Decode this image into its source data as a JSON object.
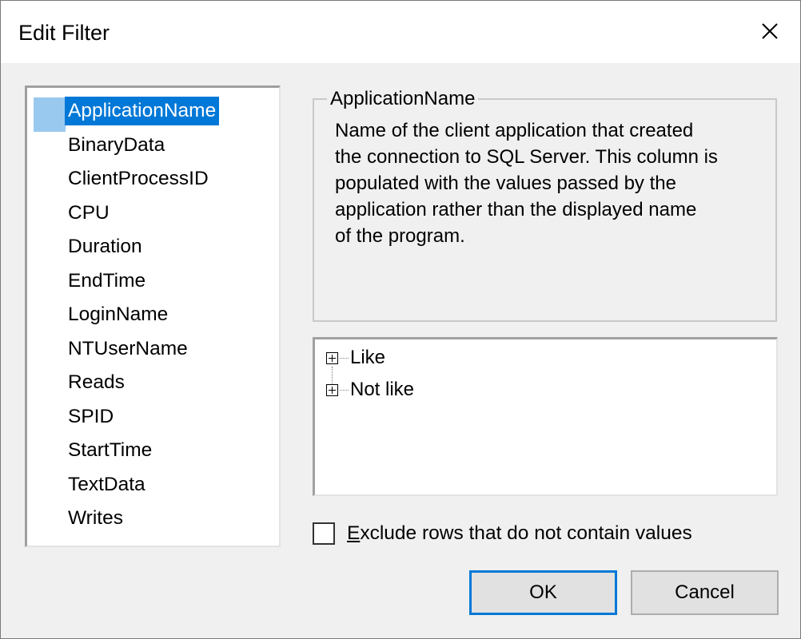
{
  "window": {
    "title": "Edit Filter",
    "close_icon": "close-icon"
  },
  "fields": {
    "selected": "ApplicationName",
    "items": [
      "ApplicationName",
      "BinaryData",
      "ClientProcessID",
      "CPU",
      "Duration",
      "EndTime",
      "LoginName",
      "NTUserName",
      "Reads",
      "SPID",
      "StartTime",
      "TextData",
      "Writes"
    ]
  },
  "description": {
    "heading": "ApplicationName",
    "lines": [
      "Name of the client application that created",
      "the connection to SQL Server. This column is",
      "populated with the values passed by the",
      "application rather than the displayed name",
      "of the program."
    ]
  },
  "operators": {
    "expander_icon": "plus-box-icon",
    "items": [
      "Like",
      "Not like"
    ]
  },
  "exclude": {
    "accelerator": "E",
    "label_rest": "xclude rows that do not contain values",
    "checked": false
  },
  "buttons": {
    "ok": "OK",
    "cancel": "Cancel"
  },
  "colors": {
    "selection": "#0078d7",
    "dialog_bg": "#f0f0f0",
    "titlebar_bg": "#ffffff"
  }
}
